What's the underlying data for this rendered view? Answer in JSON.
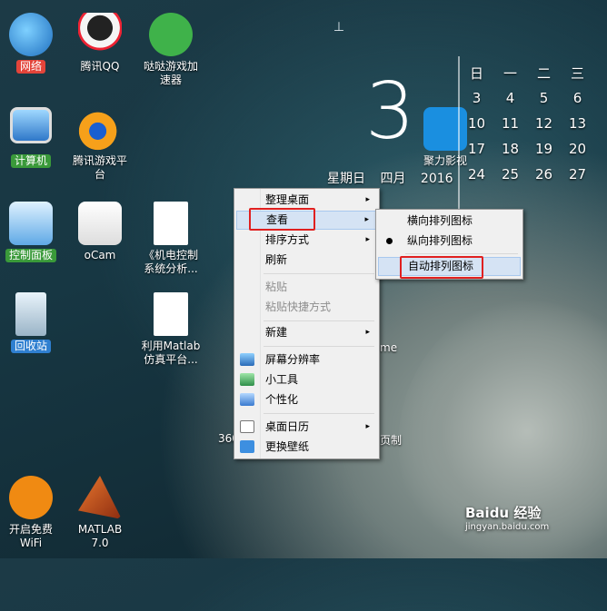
{
  "desktop": {
    "icons": [
      {
        "label": "网络",
        "icon": "network-icon"
      },
      {
        "label": "腾讯QQ",
        "icon": "qq-penguin-icon"
      },
      {
        "label": "哒哒游戏加\n速器",
        "icon": "game-accelerator-icon"
      },
      {
        "label": "计算机",
        "icon": "computer-icon"
      },
      {
        "label": "腾讯游戏平\n台",
        "icon": "tencent-games-icon"
      },
      {
        "label": "控制面板",
        "icon": "control-panel-icon"
      },
      {
        "label": "oCam",
        "icon": "ocam-icon"
      },
      {
        "label": "《机电控制\n系统分析...",
        "icon": "word-document-icon"
      },
      {
        "label": "回收站",
        "icon": "recycle-bin-icon"
      },
      {
        "label": "利用Matlab\n仿真平台...",
        "icon": "word-document-icon"
      },
      {
        "label": "开启免费\nWiFi",
        "icon": "wifi-icon"
      },
      {
        "label": "MATLAB\n7.0",
        "icon": "matlab-icon"
      },
      {
        "label": "聚力影视",
        "icon": "pptv-icon"
      }
    ],
    "partial_labels": {
      "left": "360",
      "right1": "me",
      "right2": "页制"
    }
  },
  "clock_widget": {
    "day_number": "3",
    "weekday": "星期日",
    "month": "四月",
    "year": "2016"
  },
  "calendar": {
    "headers": [
      "日",
      "一",
      "二",
      "三"
    ],
    "rows": [
      [
        "3",
        "4",
        "5",
        "6"
      ],
      [
        "10",
        "11",
        "12",
        "13"
      ],
      [
        "17",
        "18",
        "19",
        "20"
      ],
      [
        "24",
        "25",
        "26",
        "27"
      ]
    ]
  },
  "context_menu": {
    "items": [
      {
        "label": "整理桌面",
        "arrow": "▸"
      },
      {
        "label": "查看",
        "arrow": "▸"
      },
      {
        "label": "排序方式",
        "arrow": "▸"
      },
      {
        "label": "刷新"
      },
      {
        "label": "粘贴"
      },
      {
        "label": "粘贴快捷方式"
      },
      {
        "label": "新建",
        "arrow": "▸"
      },
      {
        "label": "屏幕分辨率"
      },
      {
        "label": "小工具"
      },
      {
        "label": "个性化"
      },
      {
        "label": "桌面日历",
        "arrow": "▸"
      },
      {
        "label": "更换壁纸"
      }
    ]
  },
  "view_submenu": {
    "items": [
      {
        "label": "横向排列图标"
      },
      {
        "label": "纵向排列图标"
      },
      {
        "label": "自动排列图标"
      }
    ]
  },
  "watermark": {
    "brand": "Baidu 经验",
    "url": "jingyan.baidu.com"
  },
  "colors": {
    "highlight": "#d5e3f4",
    "annotation_red": "#e02020"
  }
}
